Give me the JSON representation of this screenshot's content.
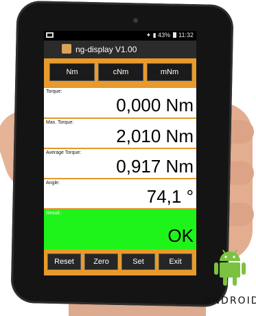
{
  "statusbar": {
    "battery": "43%",
    "time": "11:32"
  },
  "app": {
    "title": "ng-display V1.00"
  },
  "units": {
    "buttons": [
      "Nm",
      "cNm",
      "mNm"
    ]
  },
  "readings": [
    {
      "label": "Torque:",
      "value": "0,000 Nm"
    },
    {
      "label": "Max. Torque:",
      "value": "2,010 Nm"
    },
    {
      "label": "Average Torque:",
      "value": "0,917 Nm"
    },
    {
      "label": "Angle:",
      "value": "74,1 °"
    }
  ],
  "result": {
    "label": "Result:",
    "value": "OK",
    "color": "#1ff41a"
  },
  "actions": {
    "buttons": [
      "Reset",
      "Zero",
      "Set",
      "Exit"
    ]
  },
  "branding": {
    "android_text": "ANDROID",
    "android_color": "#7cc242"
  }
}
